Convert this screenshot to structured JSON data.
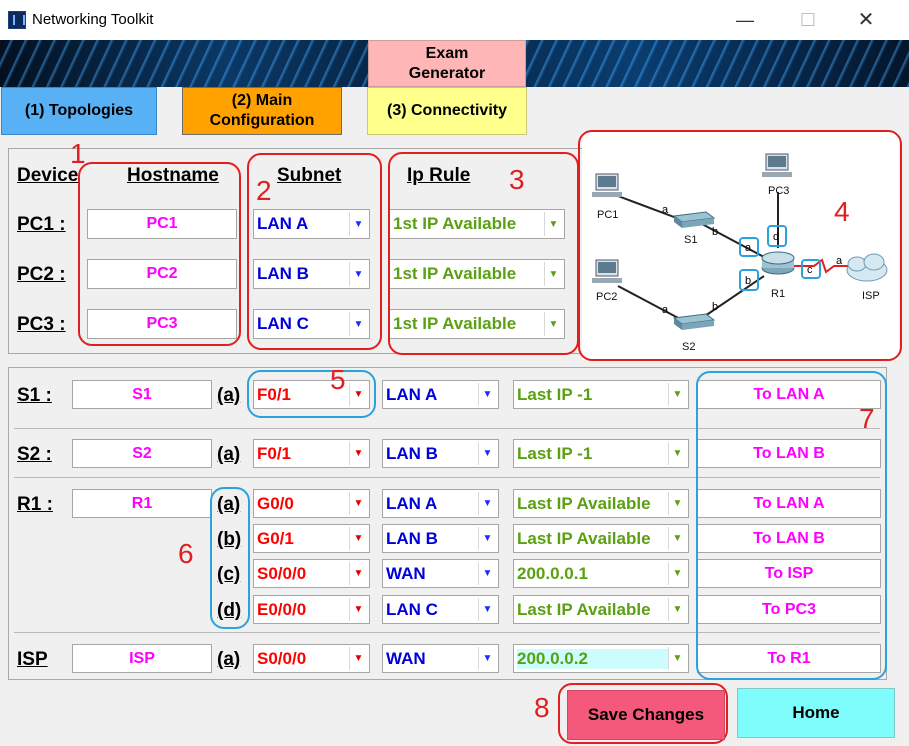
{
  "window": {
    "title": "Networking Toolkit",
    "minimize": "—",
    "maximize": "☐",
    "close": "✕"
  },
  "tabs": {
    "exam": "Exam Generator",
    "topologies": "(1) Topologies",
    "main": "(2) Main Configuration",
    "connectivity": "(3) Connectivity"
  },
  "headers": {
    "device": "Device",
    "hostname": "Hostname",
    "subnet": "Subnet",
    "iprule": "Ip Rule"
  },
  "pcs": [
    {
      "label": "PC1 :",
      "hostname": "PC1",
      "subnet": "LAN A",
      "iprule": "1st IP Available"
    },
    {
      "label": "PC2 :",
      "hostname": "PC2",
      "subnet": "LAN B",
      "iprule": "1st IP Available"
    },
    {
      "label": "PC3 :",
      "hostname": "PC3",
      "subnet": "LAN C",
      "iprule": "1st IP Available"
    }
  ],
  "devices": {
    "s1": {
      "label": "S1 :",
      "hostname": "S1",
      "port": "(a)",
      "interface": "F0/1",
      "subnet": "LAN A",
      "iprule": "Last IP -1",
      "description": "To LAN A"
    },
    "s2": {
      "label": "S2 :",
      "hostname": "S2",
      "port": "(a)",
      "interface": "F0/1",
      "subnet": "LAN B",
      "iprule": "Last IP -1",
      "description": "To LAN B"
    },
    "r1": {
      "label": "R1 :",
      "hostname": "R1",
      "ports": [
        {
          "port": "(a)",
          "interface": "G0/0",
          "subnet": "LAN A",
          "iprule": "Last IP Available",
          "description": "To LAN A"
        },
        {
          "port": "(b)",
          "interface": "G0/1",
          "subnet": "LAN B",
          "iprule": "Last IP Available",
          "description": "To LAN B"
        },
        {
          "port": "(c)",
          "interface": "S0/0/0",
          "subnet": "WAN",
          "iprule": "200.0.0.1",
          "description": "To ISP"
        },
        {
          "port": "(d)",
          "interface": "E0/0/0",
          "subnet": "LAN C",
          "iprule": "Last IP Available",
          "description": "To PC3"
        }
      ]
    },
    "isp": {
      "label": "ISP",
      "hostname": "ISP",
      "port": "(a)",
      "interface": "S0/0/0",
      "subnet": "WAN",
      "iprule": "200.0.0.2",
      "description": "To R1"
    }
  },
  "topology": {
    "nodes": [
      "PC1",
      "PC2",
      "PC3",
      "S1",
      "S2",
      "R1",
      "ISP"
    ],
    "link_labels": [
      "a",
      "b",
      "a",
      "b",
      "a",
      "b",
      "c",
      "d",
      "a"
    ]
  },
  "annotations": [
    "1",
    "2",
    "3",
    "4",
    "5",
    "6",
    "7",
    "8"
  ],
  "buttons": {
    "save": "Save Changes",
    "home": "Home"
  },
  "colors": {
    "tab_topologies": "#58b0f5",
    "tab_main": "#ffa200",
    "tab_connectivity": "#ffff8c",
    "tab_exam": "#ffb6b6",
    "save": "#f4587a",
    "home": "#7ffcfc"
  }
}
